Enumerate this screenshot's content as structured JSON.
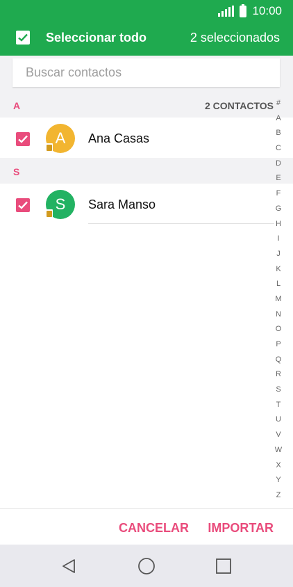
{
  "status_bar": {
    "time": "10:00",
    "signal_icon": "signal-icon",
    "battery_icon": "battery-icon"
  },
  "header": {
    "select_all_label": "Seleccionar todo",
    "selected_count": "2 seleccionados",
    "checkbox_checked": true
  },
  "search": {
    "placeholder": "Buscar contactos",
    "value": ""
  },
  "sections": [
    {
      "letter": "A",
      "count_label": "2 CONTACTOS",
      "contacts": [
        {
          "initial": "A",
          "name": "Ana Casas",
          "checked": true,
          "avatar_color": "#f2b530"
        }
      ]
    },
    {
      "letter": "S",
      "count_label": "",
      "contacts": [
        {
          "initial": "S",
          "name": "Sara Manso",
          "checked": true,
          "avatar_color": "#22b262"
        }
      ]
    }
  ],
  "index_letters": [
    "#",
    "A",
    "B",
    "C",
    "D",
    "E",
    "F",
    "G",
    "H",
    "I",
    "J",
    "K",
    "L",
    "M",
    "N",
    "O",
    "P",
    "Q",
    "R",
    "S",
    "T",
    "U",
    "V",
    "W",
    "X",
    "Y",
    "Z"
  ],
  "actions": {
    "cancel_label": "CANCELAR",
    "import_label": "IMPORTAR"
  },
  "nav_bar": {
    "back_icon": "back-triangle-icon",
    "home_icon": "home-circle-icon",
    "recents_icon": "recents-square-icon"
  },
  "colors": {
    "header_bg": "#1faa4f",
    "accent": "#e94c7c",
    "section_bg": "#f2f2f4",
    "nav_bg": "#e9e9ee"
  }
}
